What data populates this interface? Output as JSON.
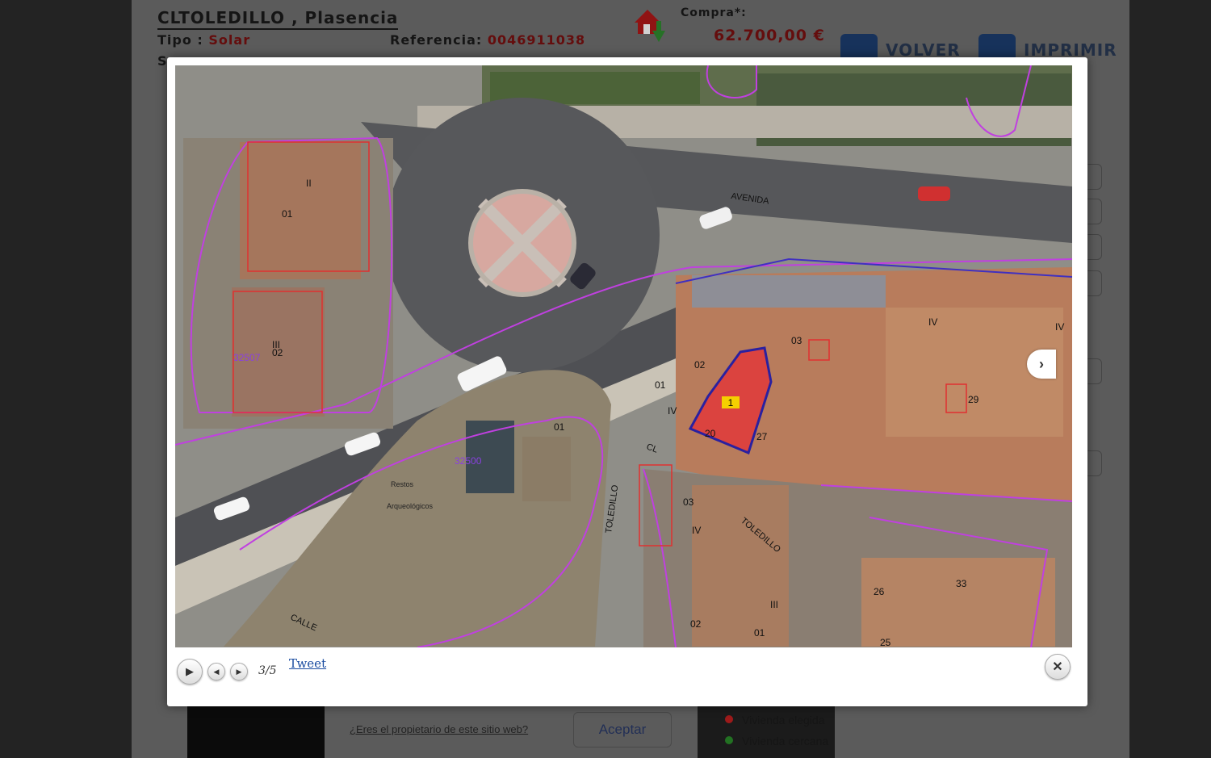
{
  "header": {
    "title": "CLTOLEDILLO , Plasencia",
    "tipo_label": "Tipo :",
    "tipo_value": "Solar",
    "referencia_label": "Referencia:",
    "referencia_value": "0046911038",
    "s_label": "S",
    "buy_label": "Compra*:",
    "buy_price": "62.700,00 €",
    "volver_label": "VOLVER",
    "imprimir_label": "IMPRIMIR"
  },
  "background_bottom": {
    "owner_link": "¿Eres el propietario de este sitio web?",
    "accept_button": "Aceptar",
    "legend": [
      "Vivienda elegida",
      "Vivienda cercana"
    ]
  },
  "lightbox": {
    "counter": "3/5",
    "tweet_label": "Tweet",
    "icons": {
      "play": "play-icon",
      "prev": "prev-icon",
      "next_small": "next-icon",
      "next_side": "chevron-right-icon",
      "close": "close-icon"
    }
  },
  "map": {
    "street_avenida": "AVENIDA",
    "street_toledillo_1": "TOLEDILLO",
    "street_toledillo_2": "TOLEDILLO",
    "street_calle": "CALLE",
    "street_cl": "CL",
    "selected_parcel": "1",
    "parcel_ids": [
      "32507",
      "32500"
    ],
    "labels_black": [
      "01",
      "02",
      "II",
      "III",
      "02",
      "01",
      "IV",
      "03",
      "IV",
      "IV",
      "29",
      "01",
      "03",
      "IV",
      "02",
      "01",
      "III",
      "26",
      "25",
      "33",
      "27",
      "20"
    ],
    "ruins_labels": [
      "Restos",
      "Arqueológicos"
    ],
    "colors": {
      "parcel_red": "#e03030",
      "boundary_magenta": "#c040e0",
      "boundary_blue": "#4030c0",
      "selected_yellow": "#f5d000"
    }
  }
}
